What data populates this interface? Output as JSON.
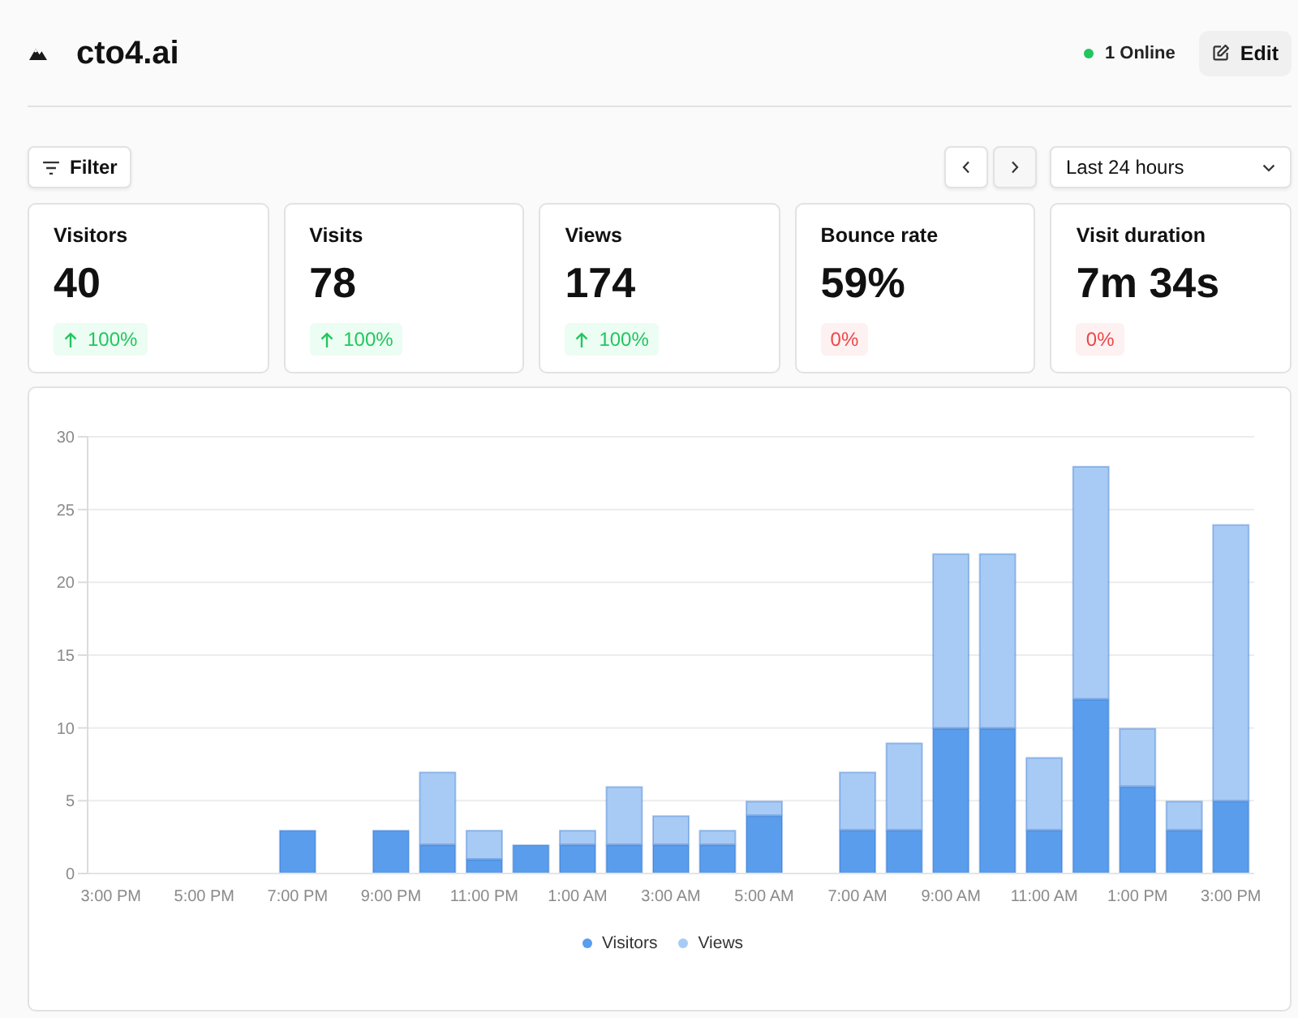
{
  "header": {
    "site_name": "cto4.ai",
    "presence": {
      "label": "1 Online",
      "active": true
    },
    "edit_button": "Edit"
  },
  "toolbar": {
    "filter_button": "Filter",
    "time_range": {
      "value": "Last 24 hours"
    }
  },
  "stats": [
    {
      "label": "Visitors",
      "value": "40",
      "change": "100%",
      "positive": true,
      "rising": true
    },
    {
      "label": "Visits",
      "value": "78",
      "change": "100%",
      "positive": true,
      "rising": true
    },
    {
      "label": "Views",
      "value": "174",
      "change": "100%",
      "positive": true,
      "rising": true
    },
    {
      "label": "Bounce rate",
      "value": "59%",
      "change": "0%",
      "positive": false
    },
    {
      "label": "Visit duration",
      "value": "7m 34s",
      "change": "0%",
      "positive": false
    }
  ],
  "chart": {
    "chart_data": {
      "type": "bar",
      "categories": [
        "3:00 PM",
        null,
        "5:00 PM",
        null,
        "7:00 PM",
        null,
        "9:00 PM",
        null,
        "11:00 PM",
        null,
        "1:00 AM",
        null,
        "3:00 AM",
        null,
        "5:00 AM",
        null,
        "7:00 AM",
        null,
        "9:00 AM",
        null,
        "11:00 AM",
        null,
        "1:00 PM",
        null,
        "3:00 PM"
      ],
      "series": [
        {
          "name": "Visitors",
          "color": "#5a9dec",
          "values": [
            0,
            0,
            0,
            0,
            3,
            0,
            3,
            2,
            1,
            2,
            2,
            2,
            2,
            2,
            4,
            0,
            3,
            3,
            10,
            10,
            3,
            12,
            6,
            3,
            5
          ]
        },
        {
          "name": "Views",
          "color": "#a8cbf5",
          "values": [
            0,
            0,
            0,
            0,
            0,
            0,
            0,
            5,
            2,
            0,
            1,
            4,
            2,
            1,
            1,
            0,
            4,
            6,
            12,
            12,
            5,
            16,
            4,
            2,
            19
          ]
        }
      ],
      "ylim": [
        0,
        30
      ],
      "yticks": [
        0,
        5,
        10,
        15,
        20,
        25,
        30
      ],
      "stacked": true,
      "grid": true
    }
  }
}
